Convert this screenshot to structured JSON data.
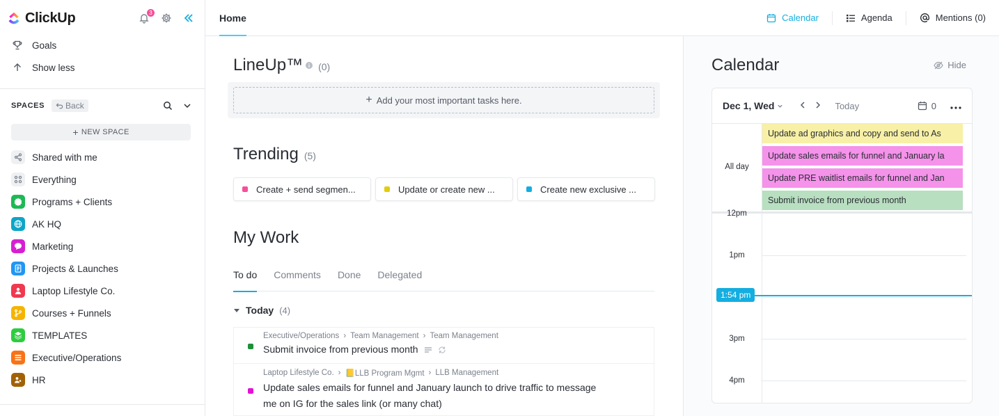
{
  "brand": {
    "name": "ClickUp"
  },
  "notifications": {
    "count": "3"
  },
  "sidebar": {
    "goals": "Goals",
    "show_less": "Show less",
    "spaces_title": "SPACES",
    "back": "Back",
    "new_space": "NEW SPACE",
    "items": [
      {
        "label": "Shared with me",
        "icon": "share-icon",
        "color": "#eef0f2"
      },
      {
        "label": "Everything",
        "icon": "grid-icon",
        "color": "#eef0f2"
      },
      {
        "label": "Programs + Clients",
        "icon": "badge-icon",
        "color": "#1db954"
      },
      {
        "label": "AK HQ",
        "icon": "globe-icon",
        "color": "#0ea5c6"
      },
      {
        "label": "Marketing",
        "icon": "chat-icon",
        "color": "#d61fd2"
      },
      {
        "label": "Projects & Launches",
        "icon": "doc-icon",
        "color": "#2196f3"
      },
      {
        "label": "Laptop Lifestyle Co.",
        "icon": "person-icon",
        "color": "#f0394f"
      },
      {
        "label": "Courses + Funnels",
        "icon": "branch-icon",
        "color": "#f5b400"
      },
      {
        "label": "TEMPLATES",
        "icon": "layers-icon",
        "color": "#2ecc40"
      },
      {
        "label": "Executive/Operations",
        "icon": "list-icon",
        "color": "#f97316"
      },
      {
        "label": "HR",
        "icon": "people-icon",
        "color": "#a16207"
      }
    ]
  },
  "header": {
    "home_tab": "Home",
    "views": [
      {
        "label": "Calendar",
        "icon": "calendar-icon",
        "active": true
      },
      {
        "label": "Agenda",
        "icon": "agenda-icon",
        "active": false
      },
      {
        "label": "Mentions (0)",
        "icon": "at-icon",
        "active": false
      }
    ]
  },
  "lineup": {
    "title": "LineUp™",
    "count": "(0)",
    "add_text": "Add your most important tasks here."
  },
  "trending": {
    "title": "Trending",
    "count": "(5)",
    "items": [
      {
        "label": "Create + send segmen...",
        "color": "#f64f9a"
      },
      {
        "label": "Update or create new ...",
        "color": "#e2cc0f"
      },
      {
        "label": "Create new exclusive ...",
        "color": "#14aee0"
      }
    ]
  },
  "mywork": {
    "title": "My Work",
    "tabs": [
      "To do",
      "Comments",
      "Done",
      "Delegated"
    ],
    "group": {
      "label": "Today",
      "count": "(4)"
    },
    "tasks": [
      {
        "crumbs": [
          "Executive/Operations",
          "Team Management",
          "Team Management"
        ],
        "name": "Submit invoice from previous month",
        "color": "#1e8f3a"
      },
      {
        "crumbs": [
          "Laptop Lifestyle Co.",
          "📒LLB Program Mgmt",
          "LLB Management"
        ],
        "name_line1": "Update sales emails for funnel and January launch to drive traffic to message",
        "name_line2": "me on IG for the sales link (or many chat)",
        "color": "#e510d6"
      }
    ]
  },
  "calendar": {
    "title": "Calendar",
    "hide": "Hide",
    "date": "Dec 1, Wed",
    "today": "Today",
    "task_count": "0",
    "all_day": "All day",
    "events": [
      {
        "label": "Update ad graphics and copy and send to As",
        "color": "#f7f0a6"
      },
      {
        "label": "Update sales emails for funnel and January la",
        "color": "#f592ea"
      },
      {
        "label": "Update PRE waitlist emails for funnel and Jan",
        "color": "#f592ea"
      },
      {
        "label": "Submit invoice from previous month",
        "color": "#b8dfc0"
      }
    ],
    "hours": [
      "12pm",
      "1pm",
      "3pm",
      "4pm"
    ],
    "now": "1:54 pm"
  }
}
